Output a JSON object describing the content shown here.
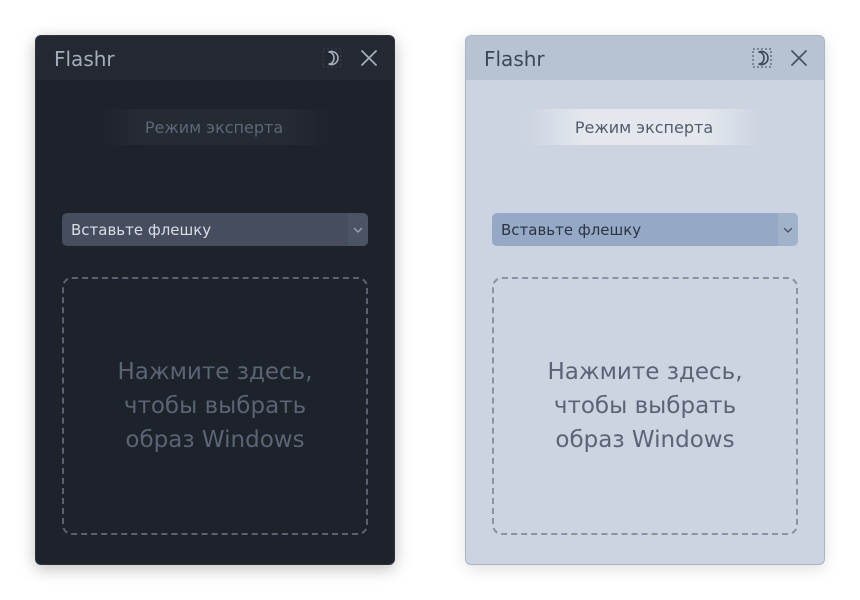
{
  "windows": [
    {
      "theme": "dark",
      "title": "Flashr",
      "expert_mode_label": "Режим эксперта",
      "drive_select": {
        "selected": "Вставьте флешку"
      },
      "dropzone_text": "Нажмите здесь,\nчтобы выбрать\nобраз Windows",
      "icons": {
        "theme_toggle": "moon-icon",
        "close": "close-icon",
        "dropdown": "chevron-down-icon"
      },
      "colors": {
        "background": "#1e222b",
        "titlebar": "#242831",
        "select": "#454d5e"
      }
    },
    {
      "theme": "light",
      "title": "Flashr",
      "expert_mode_label": "Режим эксперта",
      "drive_select": {
        "selected": "Вставьте флешку"
      },
      "dropzone_text": "Нажмите здесь,\nчтобы выбрать\nобраз Windows",
      "icons": {
        "theme_toggle": "moon-icon",
        "close": "close-icon",
        "dropdown": "chevron-down-icon"
      },
      "colors": {
        "background": "#ccd4e1",
        "titlebar": "#b8c3d2",
        "select": "#95a8c6"
      }
    }
  ]
}
